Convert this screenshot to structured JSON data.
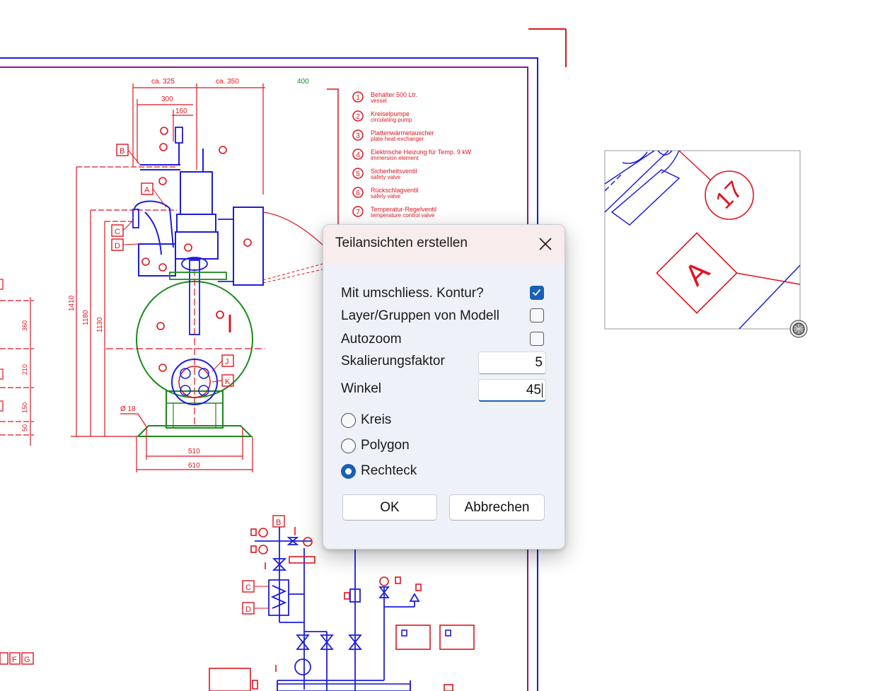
{
  "dialog": {
    "title": "Teilansichten erstellen",
    "options": [
      {
        "label": "Mit umschliess. Kontur?",
        "checked": true
      },
      {
        "label": "Layer/Gruppen von Modell",
        "checked": false
      },
      {
        "label": "Autozoom",
        "checked": false
      }
    ],
    "scale_label": "Skalierungsfaktor",
    "scale_value": "5",
    "angle_label": "Winkel",
    "angle_value": "45",
    "shapes": [
      {
        "label": "Kreis",
        "selected": false
      },
      {
        "label": "Polygon",
        "selected": false
      },
      {
        "label": "Rechteck",
        "selected": true
      }
    ],
    "ok_label": "OK",
    "cancel_label": "Abbrechen"
  },
  "drawing": {
    "top_dims": [
      "ca. 325",
      "ca. 350",
      "400"
    ],
    "sub_dims": [
      "300",
      "160"
    ],
    "legend": [
      {
        "num": "1",
        "de": "Behälter 500 Ltr.",
        "en": "vessel"
      },
      {
        "num": "2",
        "de": "Kreiselpumpe",
        "en": "circulating pump"
      },
      {
        "num": "3",
        "de": "Plattenwärmetauscher",
        "en": "plate heat-exchanger"
      },
      {
        "num": "4",
        "de": "Elektrische Heizung für Temp. 9 kW",
        "en": "immersion element"
      },
      {
        "num": "5",
        "de": "Sicherheitsventil",
        "en": "safety valve"
      },
      {
        "num": "6",
        "de": "Rückschlagventil",
        "en": "safety valve"
      },
      {
        "num": "7",
        "de": "Temperatur-Regelventil",
        "en": "temperature control valve"
      }
    ],
    "vertical_dims": [
      "1410",
      "1180",
      "1130"
    ],
    "left_dims": [
      "360",
      "210",
      "150",
      "50"
    ],
    "bottom_dims": [
      "510",
      "610"
    ],
    "foot_label": "Ø 18",
    "tag_letters": [
      "A",
      "B",
      "C",
      "D",
      "J",
      "K"
    ],
    "schematic_tags": [
      "B",
      "C",
      "D"
    ],
    "bottom_left_tags": [
      "F",
      "G"
    ]
  },
  "inset": {
    "balloon_number": "17",
    "tag_letter": "A"
  },
  "colors": {
    "drawing_red": "#e0141e",
    "drawing_blue": "#1c1ce0",
    "drawing_green": "#1a8a1a",
    "frame_purple": "#8a1a8a",
    "accent": "#1a5fb4"
  }
}
